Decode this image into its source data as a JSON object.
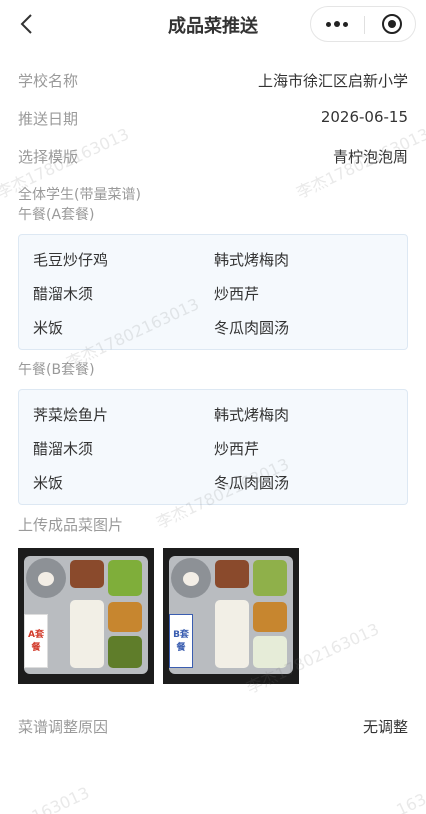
{
  "nav": {
    "title": "成品菜推送"
  },
  "info": {
    "school_label": "学校名称",
    "school_value": "上海市徐汇区启新小学",
    "date_label": "推送日期",
    "date_value": "2026-06-15",
    "template_label": "选择模版",
    "template_value": "青柠泡泡周"
  },
  "group_label": "全体学生(带量菜谱)",
  "lunch_a": {
    "label": "午餐(A套餐)",
    "dishes": [
      "毛豆炒仔鸡",
      "韩式烤梅肉",
      "醋溜木须",
      "炒西芹",
      "米饭",
      "冬瓜肉圆汤"
    ]
  },
  "lunch_b": {
    "label": "午餐(B套餐)",
    "dishes": [
      "荠菜烩鱼片",
      "韩式烤梅肉",
      "醋溜木须",
      "炒西芹",
      "米饭",
      "冬瓜肉圆汤"
    ]
  },
  "upload": {
    "label": "上传成品菜图片",
    "photos": [
      {
        "card_text": "A套餐"
      },
      {
        "card_text": "B套餐"
      }
    ]
  },
  "adjust": {
    "label": "菜谱调整原因",
    "value": "无调整"
  },
  "watermark": {
    "text": "李杰17802163013",
    "fragments": [
      "163013",
      "163"
    ]
  }
}
